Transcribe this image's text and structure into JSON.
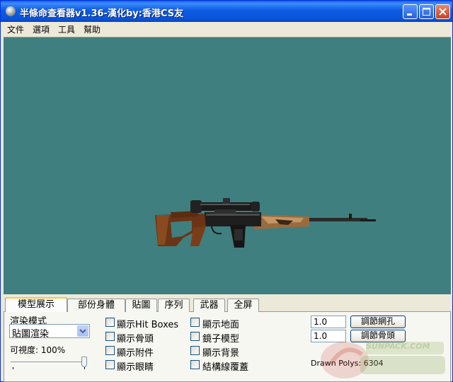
{
  "window": {
    "title": "半條命查看器v1.36-漢化by:香港CS友",
    "buttons": [
      "minimize",
      "maximize",
      "close"
    ]
  },
  "menu": {
    "items": [
      "文件",
      "選項",
      "工具",
      "幫助"
    ]
  },
  "viewport": {
    "background": "#3f7f7f",
    "model": "SVD sniper rifle with scope"
  },
  "tabs": [
    "模型展示",
    "部份身體",
    "貼圖",
    "序列",
    "武器",
    "全屏"
  ],
  "active_tab": "模型展示",
  "render": {
    "mode_label": "渲染模式",
    "mode_value": "貼圖渲染",
    "visibility_label": "可視度: 100%",
    "visibility": 100
  },
  "checkboxes": {
    "col1": [
      "顯示Hit Boxes",
      "顯示骨頭",
      "顯示附件",
      "顯示眼睛"
    ],
    "col2": [
      "顯示地面",
      "鏡子模型",
      "顯示背景",
      "結構線覆蓋"
    ]
  },
  "adjust": {
    "mesh_value": "1.0",
    "mesh_button": "調節網孔",
    "bone_value": "1.0",
    "bone_button": "調節骨頭",
    "drawn_polys": "Drawn Polys: 6304"
  },
  "watermark": "SUNPACK.COM"
}
